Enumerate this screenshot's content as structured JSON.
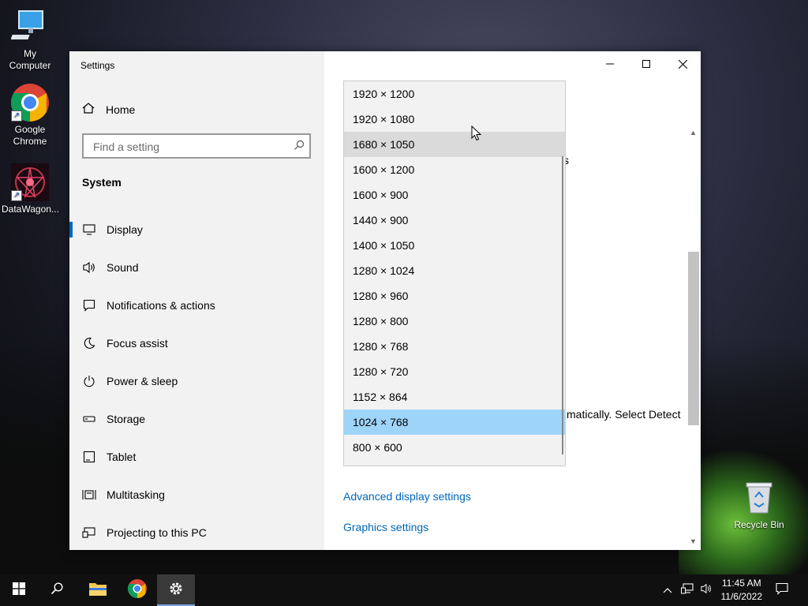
{
  "desktop": {
    "icons": [
      {
        "label_line1": "My",
        "label_line2": "Computer"
      },
      {
        "label_line1": "Google",
        "label_line2": "Chrome"
      },
      {
        "label_line1": "DataWagon...",
        "label_line2": ""
      }
    ],
    "recycle_bin": "Recycle Bin"
  },
  "window": {
    "title": "Settings",
    "home_label": "Home",
    "search_placeholder": "Find a setting",
    "section_heading": "System",
    "nav_items": [
      {
        "label": "Display",
        "icon": "monitor-icon"
      },
      {
        "label": "Sound",
        "icon": "speaker-icon"
      },
      {
        "label": "Notifications & actions",
        "icon": "message-icon"
      },
      {
        "label": "Focus assist",
        "icon": "moon-icon"
      },
      {
        "label": "Power & sleep",
        "icon": "power-icon"
      },
      {
        "label": "Storage",
        "icon": "storage-icon"
      },
      {
        "label": "Tablet",
        "icon": "tablet-icon"
      },
      {
        "label": "Multitasking",
        "icon": "multitasking-icon"
      },
      {
        "label": "Projecting to this PC",
        "icon": "projecting-icon"
      }
    ],
    "selected_nav": "Display"
  },
  "content": {
    "partial_text": "matically. Select Detect",
    "partial_fragment": "s",
    "advanced_link": "Advanced display settings",
    "graphics_link": "Graphics settings"
  },
  "resolution_dropdown": {
    "options": [
      "1920 × 1200",
      "1920 × 1080",
      "1680 × 1050",
      "1600 × 1200",
      "1600 × 900",
      "1440 × 900",
      "1400 × 1050",
      "1280 × 1024",
      "1280 × 960",
      "1280 × 800",
      "1280 × 768",
      "1280 × 720",
      "1152 × 864",
      "1024 × 768",
      "800 × 600"
    ],
    "hovered": "1680 × 1050",
    "selected": "1024 × 768"
  },
  "taskbar": {
    "time": "11:45 AM",
    "date": "11/6/2022"
  },
  "colors": {
    "accent": "#0067c0",
    "link": "#0067b8",
    "selected_option": "#9fd4f9",
    "hover_option": "#dadada"
  }
}
